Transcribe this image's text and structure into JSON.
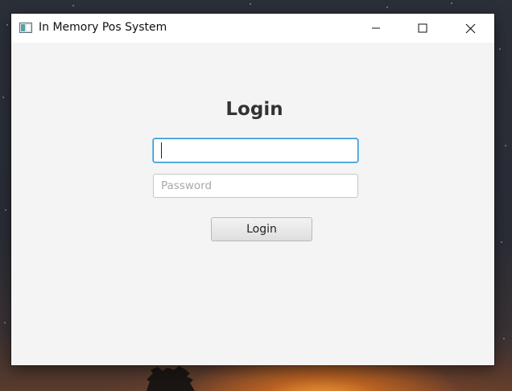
{
  "window": {
    "title": "In Memory Pos System",
    "icon": "app-window-icon",
    "controls": {
      "minimize_icon": "minimize-icon",
      "maximize_icon": "maximize-icon",
      "close_icon": "close-icon"
    }
  },
  "login_form": {
    "heading": "Login",
    "username": {
      "value": "",
      "placeholder": ""
    },
    "password": {
      "value": "",
      "placeholder": "Password"
    },
    "submit_label": "Login"
  },
  "colors": {
    "focus_border": "#2496d8",
    "window_background": "#f4f4f4",
    "titlebar_background": "#ffffff",
    "heading_text": "#333333"
  }
}
